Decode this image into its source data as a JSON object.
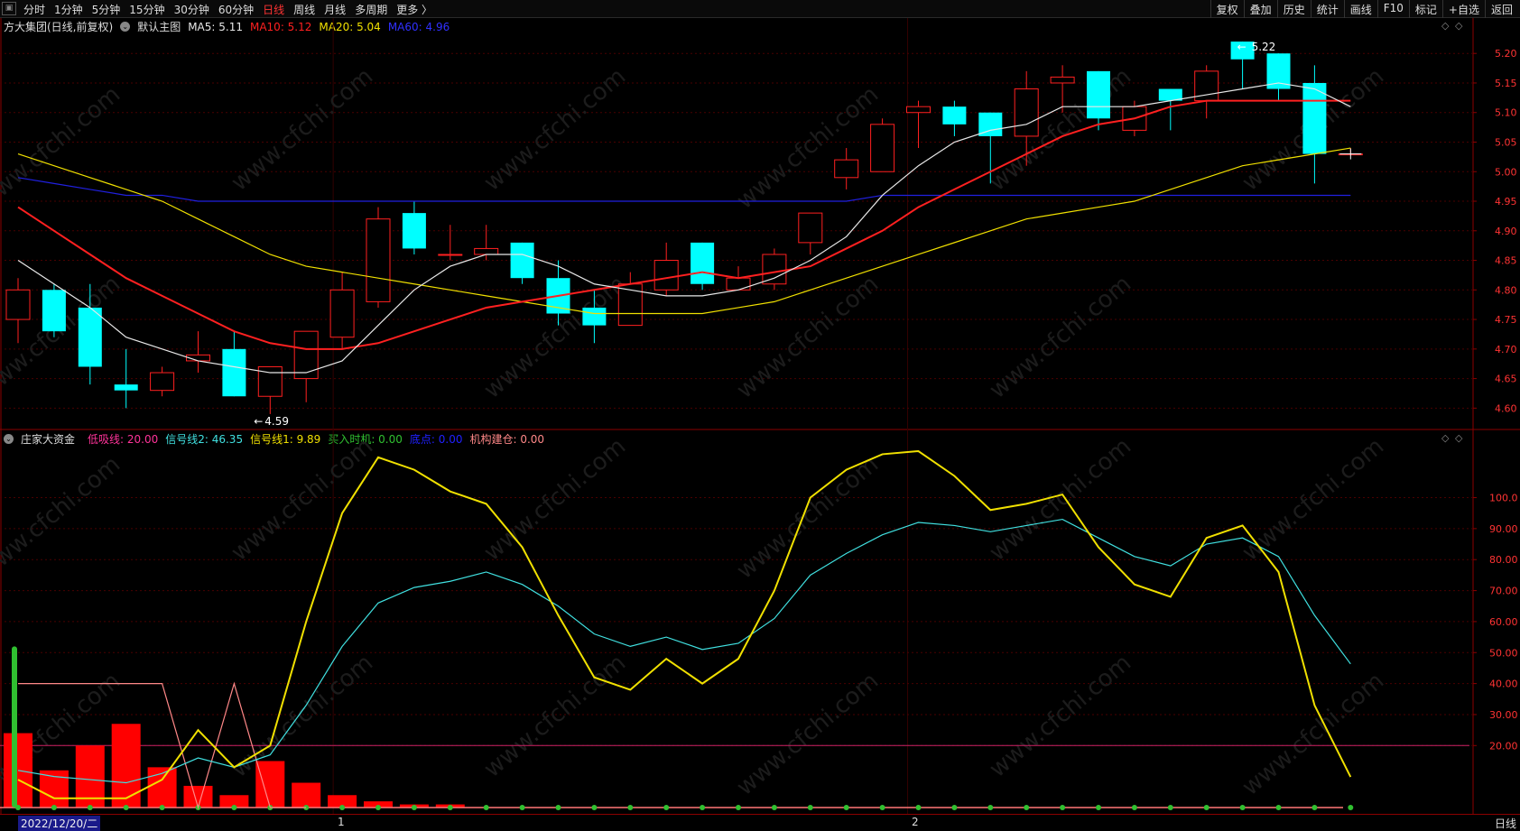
{
  "toolbar": {
    "periods": [
      {
        "label": "分时",
        "active": false
      },
      {
        "label": "1分钟",
        "active": false
      },
      {
        "label": "5分钟",
        "active": false
      },
      {
        "label": "15分钟",
        "active": false
      },
      {
        "label": "30分钟",
        "active": false
      },
      {
        "label": "60分钟",
        "active": false
      },
      {
        "label": "日线",
        "active": true
      },
      {
        "label": "周线",
        "active": false
      },
      {
        "label": "月线",
        "active": false
      },
      {
        "label": "多周期",
        "active": false
      },
      {
        "label": "更多 〉",
        "active": false
      }
    ],
    "right_buttons": [
      "复权",
      "叠加",
      "历史",
      "统计",
      "画线",
      "F10",
      "标记",
      "+自选",
      "返回"
    ]
  },
  "main_chart": {
    "stock_name": "方大集团(日线,前复权)",
    "template": "默认主图",
    "ma_items": [
      {
        "label": "MA5: 5.11",
        "color": "#e8e8e8"
      },
      {
        "label": "MA10: 5.12",
        "color": "#ff2020"
      },
      {
        "label": "MA20: 5.04",
        "color": "#f0e000"
      },
      {
        "label": "MA60: 4.96",
        "color": "#3030ff"
      }
    ],
    "high_label": "5.22",
    "low_label": "4.59",
    "y_ticks": [
      "5.20",
      "5.15",
      "5.10",
      "5.05",
      "5.00",
      "4.95",
      "4.90",
      "4.85",
      "4.80",
      "4.75",
      "4.70",
      "4.65",
      "4.60"
    ]
  },
  "indicator": {
    "name": "庄家大资金",
    "items": [
      {
        "label": "低吸线: 20.00",
        "color": "#ff3399"
      },
      {
        "label": "信号线2: 46.35",
        "color": "#40e0e0"
      },
      {
        "label": "信号线1: 9.89",
        "color": "#f0e000"
      },
      {
        "label": "买入时机: 0.00",
        "color": "#30c030"
      },
      {
        "label": "底点: 0.00",
        "color": "#2020ff"
      },
      {
        "label": "机构建仓: 0.00",
        "color": "#ff8888"
      }
    ],
    "y_ticks": [
      "100.0",
      "90.00",
      "80.00",
      "70.00",
      "60.00",
      "50.00",
      "40.00",
      "30.00",
      "20.00"
    ]
  },
  "date_bar": {
    "current_date": "2022/12/20/二",
    "month_marks": [
      "1",
      "2"
    ],
    "period_label": "日线"
  },
  "watermark": "www.cfchi.com",
  "chart_data": {
    "type": "candlestick",
    "y_range": [
      4.57,
      5.24
    ],
    "colors": {
      "up": "#ff2020",
      "down": "#00ffff"
    },
    "candles": [
      {
        "o": 4.75,
        "c": 4.8,
        "h": 4.82,
        "l": 4.71
      },
      {
        "o": 4.8,
        "c": 4.73,
        "h": 4.81,
        "l": 4.72
      },
      {
        "o": 4.77,
        "c": 4.67,
        "h": 4.81,
        "l": 4.64
      },
      {
        "o": 4.64,
        "c": 4.63,
        "h": 4.7,
        "l": 4.6
      },
      {
        "o": 4.63,
        "c": 4.66,
        "h": 4.67,
        "l": 4.62
      },
      {
        "o": 4.68,
        "c": 4.69,
        "h": 4.73,
        "l": 4.66
      },
      {
        "o": 4.7,
        "c": 4.62,
        "h": 4.73,
        "l": 4.62
      },
      {
        "o": 4.62,
        "c": 4.67,
        "h": 4.67,
        "l": 4.59
      },
      {
        "o": 4.65,
        "c": 4.73,
        "h": 4.73,
        "l": 4.61
      },
      {
        "o": 4.72,
        "c": 4.8,
        "h": 4.83,
        "l": 4.7
      },
      {
        "o": 4.78,
        "c": 4.92,
        "h": 4.94,
        "l": 4.77
      },
      {
        "o": 4.93,
        "c": 4.87,
        "h": 4.95,
        "l": 4.86
      },
      {
        "o": 4.86,
        "c": 4.86,
        "h": 4.91,
        "l": 4.85
      },
      {
        "o": 4.86,
        "c": 4.87,
        "h": 4.91,
        "l": 4.85
      },
      {
        "o": 4.88,
        "c": 4.82,
        "h": 4.88,
        "l": 4.81
      },
      {
        "o": 4.82,
        "c": 4.76,
        "h": 4.85,
        "l": 4.74
      },
      {
        "o": 4.77,
        "c": 4.74,
        "h": 4.8,
        "l": 4.71
      },
      {
        "o": 4.74,
        "c": 4.81,
        "h": 4.83,
        "l": 4.74
      },
      {
        "o": 4.8,
        "c": 4.85,
        "h": 4.88,
        "l": 4.79
      },
      {
        "o": 4.88,
        "c": 4.81,
        "h": 4.88,
        "l": 4.8
      },
      {
        "o": 4.8,
        "c": 4.82,
        "h": 4.84,
        "l": 4.8
      },
      {
        "o": 4.81,
        "c": 4.86,
        "h": 4.87,
        "l": 4.8
      },
      {
        "o": 4.88,
        "c": 4.93,
        "h": 4.93,
        "l": 4.86
      },
      {
        "o": 4.99,
        "c": 5.02,
        "h": 5.04,
        "l": 4.97
      },
      {
        "o": 5.0,
        "c": 5.08,
        "h": 5.09,
        "l": 5.0
      },
      {
        "o": 5.1,
        "c": 5.11,
        "h": 5.12,
        "l": 5.04
      },
      {
        "o": 5.11,
        "c": 5.08,
        "h": 5.12,
        "l": 5.06
      },
      {
        "o": 5.1,
        "c": 5.06,
        "h": 5.1,
        "l": 4.98
      },
      {
        "o": 5.06,
        "c": 5.14,
        "h": 5.17,
        "l": 5.01
      },
      {
        "o": 5.15,
        "c": 5.16,
        "h": 5.18,
        "l": 5.1
      },
      {
        "o": 5.17,
        "c": 5.09,
        "h": 5.17,
        "l": 5.07
      },
      {
        "o": 5.07,
        "c": 5.11,
        "h": 5.12,
        "l": 5.06
      },
      {
        "o": 5.14,
        "c": 5.12,
        "h": 5.14,
        "l": 5.07
      },
      {
        "o": 5.12,
        "c": 5.17,
        "h": 5.18,
        "l": 5.09
      },
      {
        "o": 5.22,
        "c": 5.19,
        "h": 5.22,
        "l": 5.14
      },
      {
        "o": 5.2,
        "c": 5.14,
        "h": 5.2,
        "l": 5.12
      },
      {
        "o": 5.15,
        "c": 5.03,
        "h": 5.18,
        "l": 4.98
      },
      {
        "o": 5.03,
        "c": 5.03,
        "h": 5.04,
        "l": 5.03
      }
    ],
    "ma5": [
      4.85,
      4.81,
      4.77,
      4.72,
      4.7,
      4.68,
      4.67,
      4.66,
      4.66,
      4.68,
      4.74,
      4.8,
      4.84,
      4.86,
      4.86,
      4.84,
      4.81,
      4.8,
      4.79,
      4.79,
      4.8,
      4.82,
      4.85,
      4.89,
      4.96,
      5.01,
      5.05,
      5.07,
      5.08,
      5.11,
      5.11,
      5.11,
      5.12,
      5.13,
      5.14,
      5.15,
      5.14,
      5.11
    ],
    "ma10": [
      4.94,
      4.9,
      4.86,
      4.82,
      4.79,
      4.76,
      4.73,
      4.71,
      4.7,
      4.7,
      4.71,
      4.73,
      4.75,
      4.77,
      4.78,
      4.79,
      4.8,
      4.81,
      4.82,
      4.83,
      4.82,
      4.83,
      4.84,
      4.87,
      4.9,
      4.94,
      4.97,
      5.0,
      5.03,
      5.06,
      5.08,
      5.09,
      5.11,
      5.12,
      5.12,
      5.12,
      5.12,
      5.12
    ],
    "ma20": [
      5.03,
      5.01,
      4.99,
      4.97,
      4.95,
      4.92,
      4.89,
      4.86,
      4.84,
      4.83,
      4.82,
      4.81,
      4.8,
      4.79,
      4.78,
      4.77,
      4.76,
      4.76,
      4.76,
      4.76,
      4.77,
      4.78,
      4.8,
      4.82,
      4.84,
      4.86,
      4.88,
      4.9,
      4.92,
      4.93,
      4.94,
      4.95,
      4.97,
      4.99,
      5.01,
      5.02,
      5.03,
      5.04
    ],
    "ma60": [
      4.99,
      4.98,
      4.97,
      4.96,
      4.96,
      4.95,
      4.95,
      4.95,
      4.95,
      4.95,
      4.95,
      4.95,
      4.95,
      4.95,
      4.95,
      4.95,
      4.95,
      4.95,
      4.95,
      4.95,
      4.95,
      4.95,
      4.95,
      4.95,
      4.96,
      4.96,
      4.96,
      4.96,
      4.96,
      4.96,
      4.96,
      4.96,
      4.96,
      4.96,
      4.96,
      4.96,
      4.96,
      4.96
    ],
    "indicator_series": {
      "y_range": [
        0,
        115
      ],
      "signal1": [
        9.0,
        3.0,
        3.0,
        3.0,
        9.0,
        25.0,
        13.0,
        20.0,
        60.0,
        95.0,
        113.0,
        109.0,
        102.0,
        98.0,
        84.0,
        62.0,
        42.0,
        38.0,
        48.0,
        40.0,
        48.0,
        70.0,
        100.0,
        109.0,
        114.0,
        115.0,
        107.0,
        96.0,
        98.0,
        101.0,
        84.0,
        72.0,
        68.0,
        87.0,
        91.0,
        76.0,
        33.0,
        9.89
      ],
      "signal2": [
        12.0,
        10.0,
        9.0,
        8.0,
        11.0,
        16.0,
        13.0,
        17.0,
        33.0,
        52.0,
        66.0,
        71.0,
        73.0,
        76.0,
        72.0,
        65.0,
        56.0,
        52.0,
        55.0,
        51.0,
        53.0,
        61.0,
        75.0,
        82.0,
        88.0,
        92.0,
        91.0,
        89.0,
        91.0,
        93.0,
        87.0,
        81.0,
        78.0,
        85.0,
        87.0,
        81.0,
        62.0,
        46.35
      ],
      "bars": [
        24,
        12,
        20,
        27,
        13,
        7,
        4,
        15,
        8,
        4,
        2,
        1,
        1,
        0,
        0,
        0,
        0,
        0,
        0,
        0,
        0,
        0,
        0,
        0,
        0,
        0,
        0,
        0,
        0,
        0,
        0,
        0,
        0,
        0,
        0,
        0,
        0,
        0
      ],
      "jigou": [
        40,
        40,
        40,
        40,
        40,
        0,
        40,
        0,
        0,
        0,
        0,
        0,
        0,
        0,
        0,
        0,
        0,
        0,
        0,
        0,
        0,
        0,
        0,
        0,
        0,
        0,
        0,
        0,
        0,
        0,
        0,
        0,
        0,
        0,
        0,
        0,
        0,
        0
      ],
      "green_bar_height": 52,
      "low_line": 20
    }
  }
}
